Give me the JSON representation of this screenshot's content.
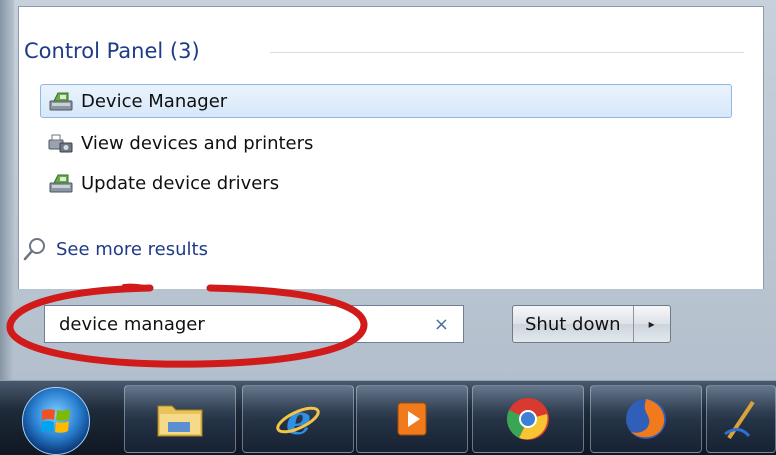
{
  "section": {
    "title": "Control Panel (3)"
  },
  "results": [
    {
      "label": "Device Manager",
      "icon": "device-manager-icon",
      "selected": true
    },
    {
      "label": "View devices and printers",
      "icon": "devices-printers-icon",
      "selected": false
    },
    {
      "label": "Update device drivers",
      "icon": "device-manager-icon",
      "selected": false
    }
  ],
  "see_more": {
    "label": "See more results",
    "icon": "search-icon"
  },
  "search": {
    "value": "device manager",
    "clear_label": "×"
  },
  "shutdown": {
    "label": "Shut down",
    "arrow": "▸"
  },
  "colors": {
    "annotation": "#d11a1a",
    "link": "#1e3b87",
    "selection": "#d6e8fa"
  },
  "taskbar": {
    "items": [
      {
        "name": "start-orb",
        "icon": "windows-logo-icon"
      },
      {
        "name": "taskbar-explorer",
        "icon": "folder-icon"
      },
      {
        "name": "taskbar-ie",
        "icon": "internet-explorer-icon"
      },
      {
        "name": "taskbar-media",
        "icon": "media-player-icon"
      },
      {
        "name": "taskbar-chrome",
        "icon": "chrome-icon"
      },
      {
        "name": "taskbar-firefox",
        "icon": "firefox-icon"
      },
      {
        "name": "taskbar-paint",
        "icon": "pen-tool-icon"
      }
    ]
  }
}
